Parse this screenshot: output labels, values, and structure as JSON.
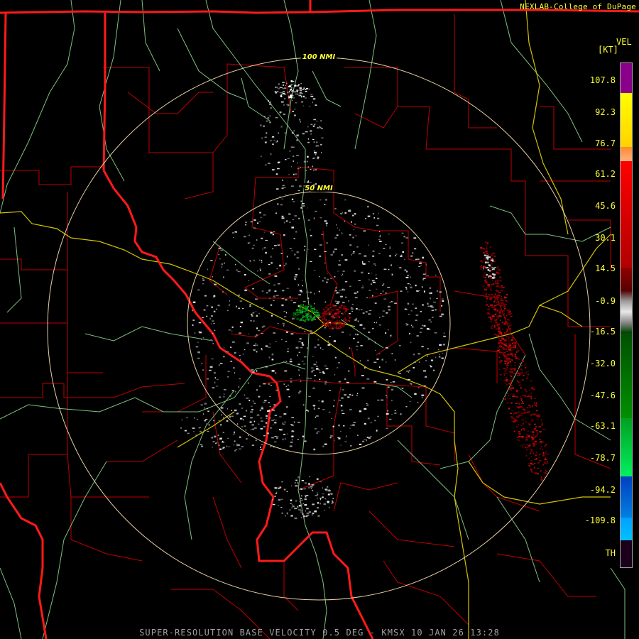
{
  "credit": "NEXLAB-College of DuPage",
  "legend": {
    "product": "VEL",
    "unit": "[KT]",
    "labels": [
      "107.8",
      "92.3",
      "76.7",
      "61.2",
      "45.6",
      "30.1",
      "14.5",
      "-0.9",
      "-16.5",
      "-32.0",
      "-47.6",
      "-63.1",
      "-78.7",
      "-94.2",
      "-109.8",
      "TH"
    ],
    "colors": {
      "purple": "#8a008a",
      "yellow": "#ffff00",
      "orange": "#ff9a4a",
      "red": "#ff0000",
      "darkred": "#6a0000",
      "gray": "#a0a0a0",
      "darkgreen": "#006a00",
      "green": "#00e040",
      "blue": "#0060d0",
      "cyan": "#00aaff",
      "th": "#1a001a"
    }
  },
  "map": {
    "ring_labels": [
      "100 NMI",
      "50 NMI"
    ],
    "colors": {
      "state_borders": "#ff1a1a",
      "county_lines": "#c00000",
      "highways": "#d4c400",
      "rivers": "#7ec07e",
      "range_rings": "#e8cfa0"
    }
  },
  "caption": "SUPER-RESOLUTION BASE VELOCITY 0.5 DEG - KMSX 10 JAN 26 13:28"
}
